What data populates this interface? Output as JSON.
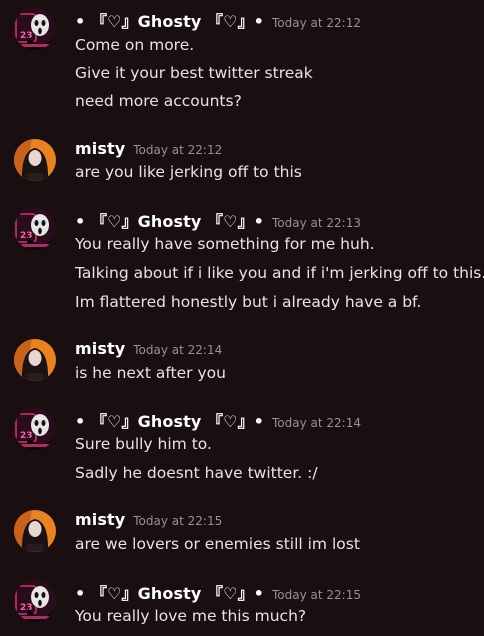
{
  "colors": {
    "background": "#1a0f10",
    "username": "#ffffff",
    "timestamp": "#9a8f91",
    "message_text": "#e8e3e4"
  },
  "groups": [
    {
      "author": "• 『♡』Ghosty 『♡』•",
      "avatar_icon": "ghostface-avatar-icon",
      "time": "Today at 22:12",
      "messages": [
        "Come on more.",
        "Give it your best twitter streak",
        "need more accounts?"
      ]
    },
    {
      "author": "misty",
      "avatar_icon": "misty-avatar-icon",
      "time": "Today at 22:12",
      "messages": [
        "are you like jerking off to this"
      ]
    },
    {
      "author": "• 『♡』Ghosty 『♡』•",
      "avatar_icon": "ghostface-avatar-icon",
      "time": "Today at 22:13",
      "messages": [
        "You really have something for me huh.",
        "Talking about if i like you and if i'm jerking off to this.",
        "Im flattered honestly but i already have a bf."
      ]
    },
    {
      "author": "misty",
      "avatar_icon": "misty-avatar-icon",
      "time": "Today at 22:14",
      "messages": [
        "is he next after you"
      ]
    },
    {
      "author": "• 『♡』Ghosty 『♡』•",
      "avatar_icon": "ghostface-avatar-icon",
      "time": "Today at 22:14",
      "messages": [
        "Sure bully him to.",
        "Sadly he doesnt have twitter. :/"
      ]
    },
    {
      "author": "misty",
      "avatar_icon": "misty-avatar-icon",
      "time": "Today at 22:15",
      "messages": [
        "are we lovers or enemies still im lost"
      ]
    },
    {
      "author": "• 『♡』Ghosty 『♡』•",
      "avatar_icon": "ghostface-avatar-icon",
      "time": "Today at 22:15",
      "messages": [
        "You really love me this much?"
      ]
    }
  ]
}
